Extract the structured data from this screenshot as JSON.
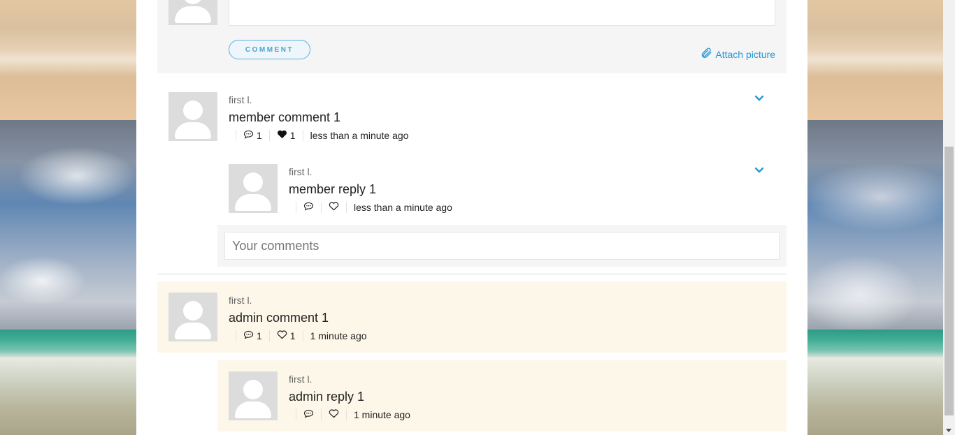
{
  "composer": {
    "comment_button": "COMMENT",
    "attach_label": "Attach picture"
  },
  "comments": [
    {
      "author": "first l.",
      "text": "member comment 1",
      "reply_count": "1",
      "like_count": "1",
      "liked": true,
      "time": "less than a minute ago",
      "reply": {
        "author": "first l.",
        "text": "member reply 1",
        "time": "less than a minute ago"
      },
      "reply_placeholder": "Your comments"
    },
    {
      "author": "first l.",
      "text": "admin comment 1",
      "reply_count": "1",
      "like_count": "1",
      "liked": false,
      "time": "1 minute ago",
      "reply": {
        "author": "first l.",
        "text": "admin reply 1",
        "time": "1 minute ago"
      }
    }
  ],
  "colors": {
    "accent": "#2596d6",
    "admin_background": "#fdf7ea",
    "panel_background": "#f5f5f5"
  }
}
